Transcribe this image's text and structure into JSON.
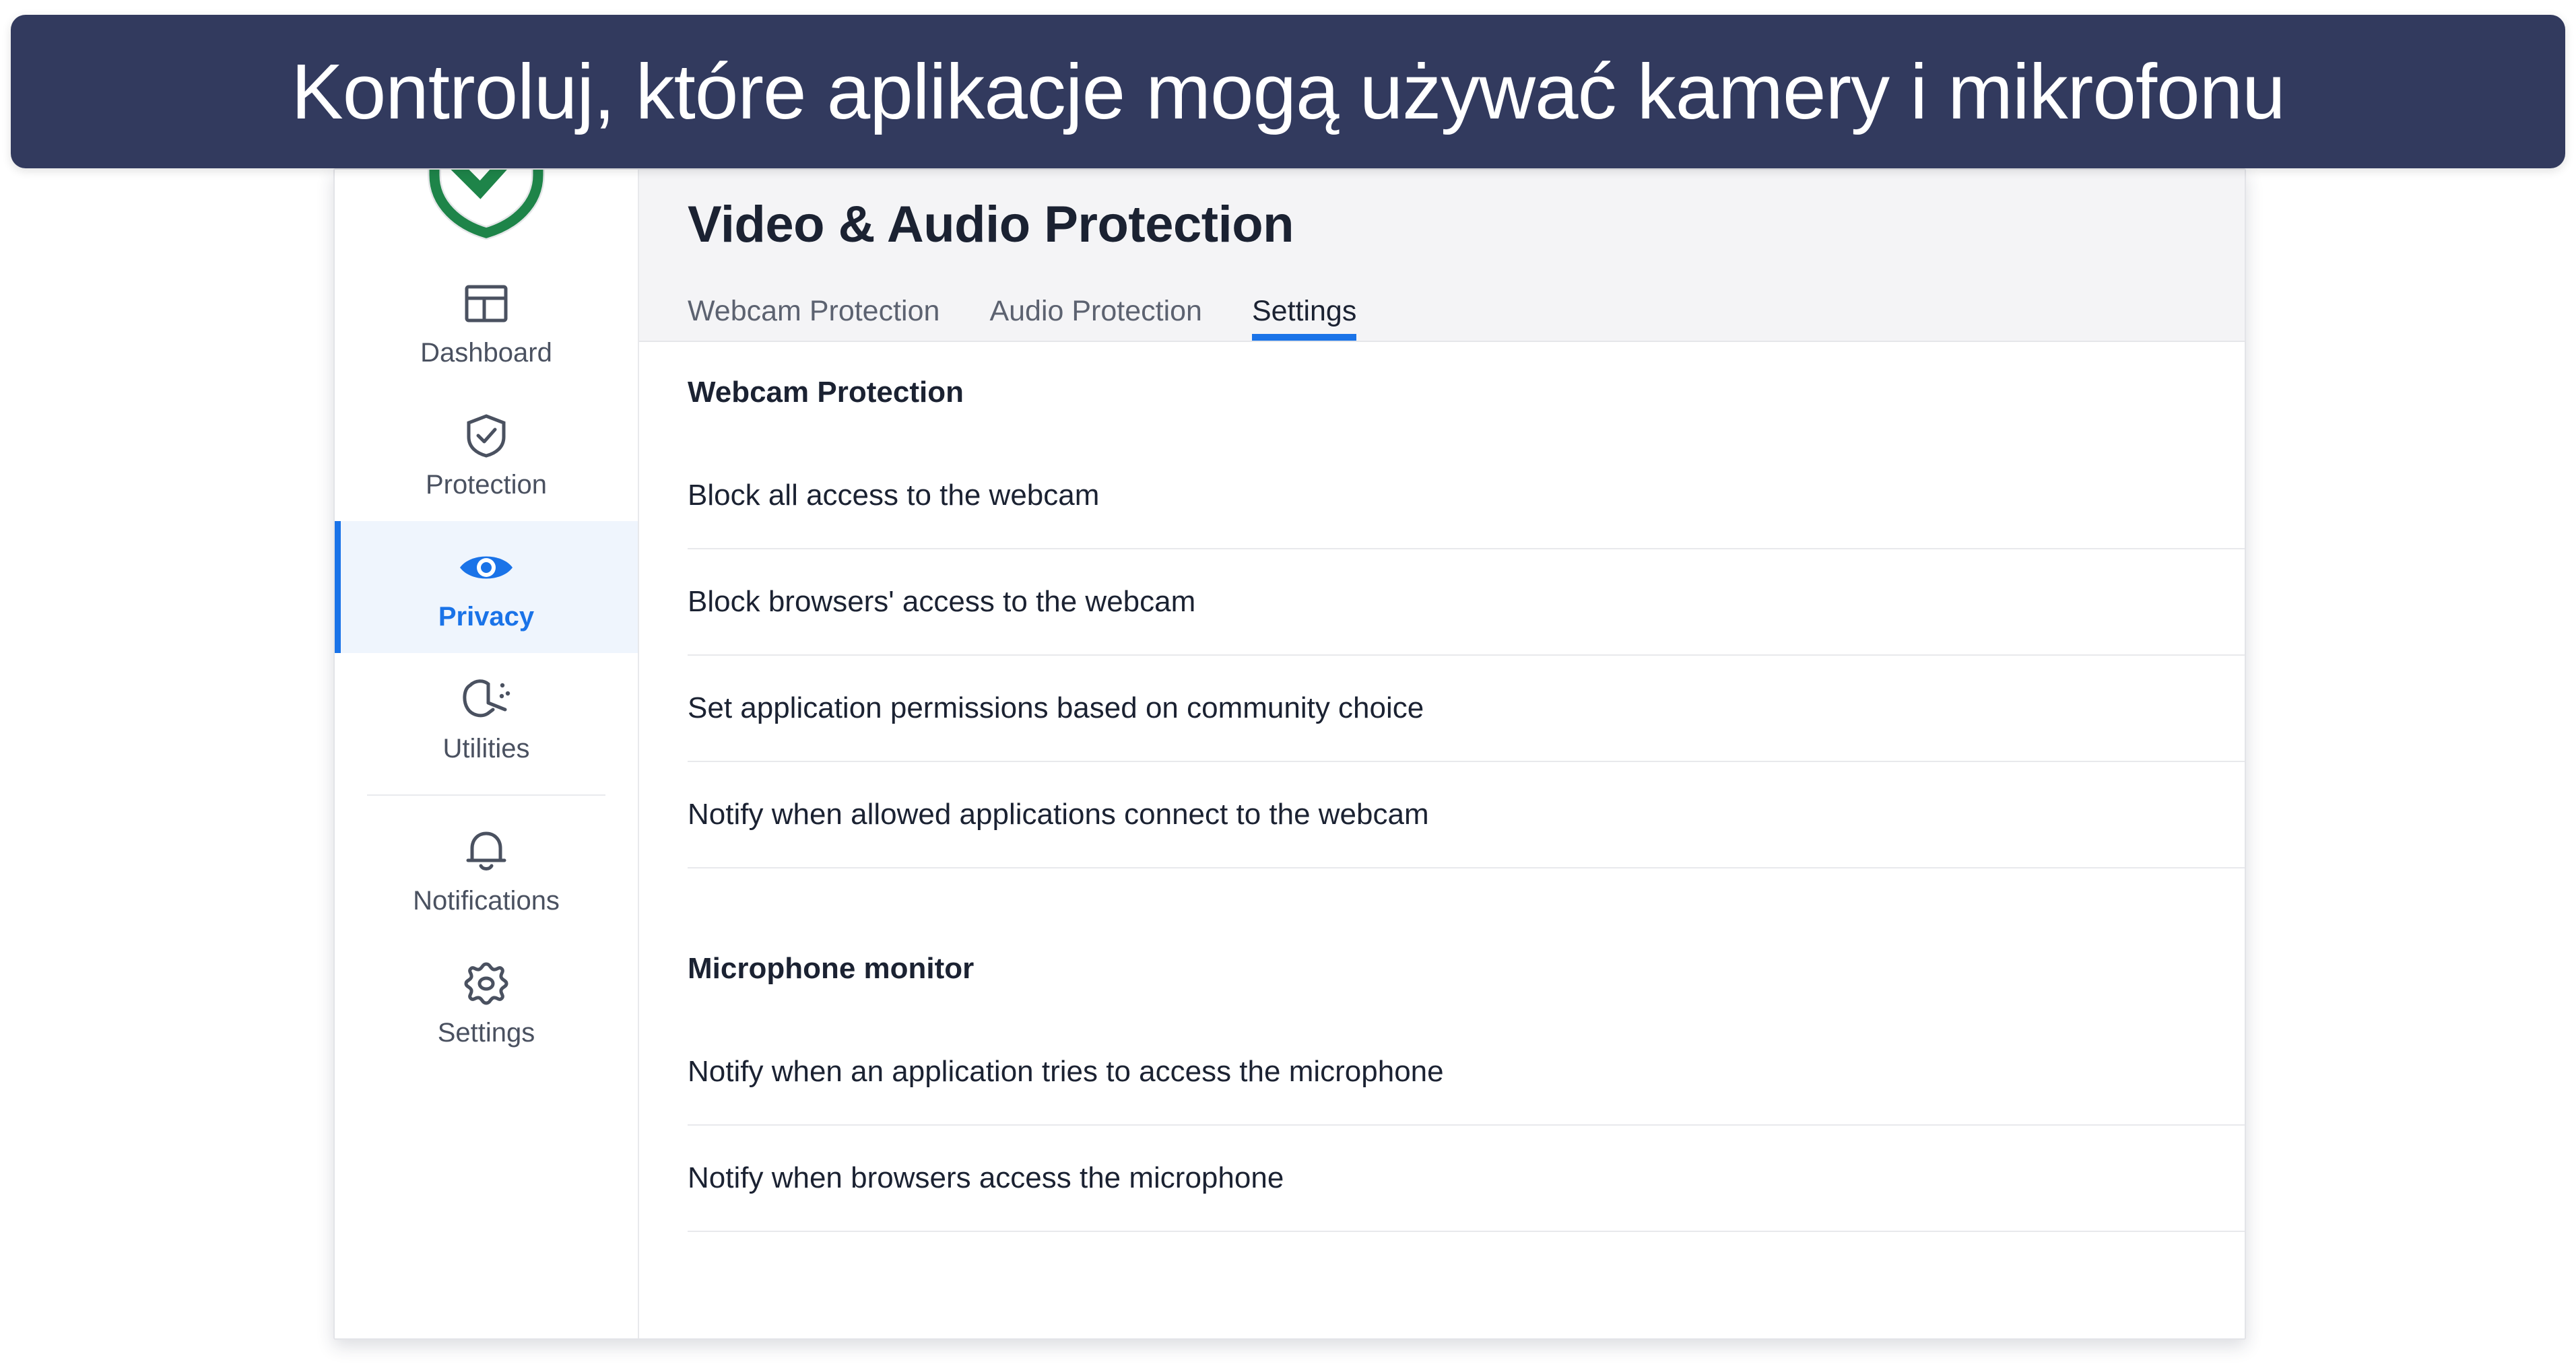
{
  "banner": {
    "text": "Kontroluj, które aplikacje mogą używać kamery i mikrofonu",
    "background_color": "#323a5e",
    "text_color": "#ffffff"
  },
  "colors": {
    "accent_blue": "#1a73e8",
    "toggle_off_gray": "#9ea1a8",
    "shield_green": "#1e8449",
    "header_bg": "#f4f4f6",
    "active_nav_bg": "#eff5fd"
  },
  "sidebar": {
    "logo": "shield-check-logo",
    "items": [
      {
        "label": "Dashboard",
        "icon": "dashboard-icon",
        "active": false
      },
      {
        "label": "Protection",
        "icon": "shield-check-icon",
        "active": false
      },
      {
        "label": "Privacy",
        "icon": "eye-icon",
        "active": true
      },
      {
        "label": "Utilities",
        "icon": "utilities-icon",
        "active": false
      },
      {
        "label": "Notifications",
        "icon": "bell-icon",
        "active": false
      },
      {
        "label": "Settings",
        "icon": "gear-icon",
        "active": false
      }
    ]
  },
  "main": {
    "title": "Video & Audio Protection",
    "tabs": [
      {
        "label": "Webcam Protection",
        "active": false
      },
      {
        "label": "Audio Protection",
        "active": false
      },
      {
        "label": "Settings",
        "active": true
      }
    ],
    "sections": [
      {
        "heading": "Webcam Protection",
        "heading_toggle": "on",
        "rows": [
          {
            "label": "Block all access to the webcam",
            "toggle": "off"
          },
          {
            "label": "Block browsers' access to the webcam",
            "toggle": "off"
          },
          {
            "label": "Set application permissions based on community choice",
            "toggle": "on"
          },
          {
            "label": "Notify when allowed applications connect to the webcam",
            "toggle": "off"
          }
        ]
      },
      {
        "heading": "Microphone monitor",
        "heading_toggle": "on",
        "rows": [
          {
            "label": "Notify when an application tries to access the microphone",
            "toggle": "off"
          },
          {
            "label": "Notify when browsers access the microphone",
            "toggle": "off"
          }
        ]
      }
    ],
    "clipped_row_toggle": "on"
  }
}
